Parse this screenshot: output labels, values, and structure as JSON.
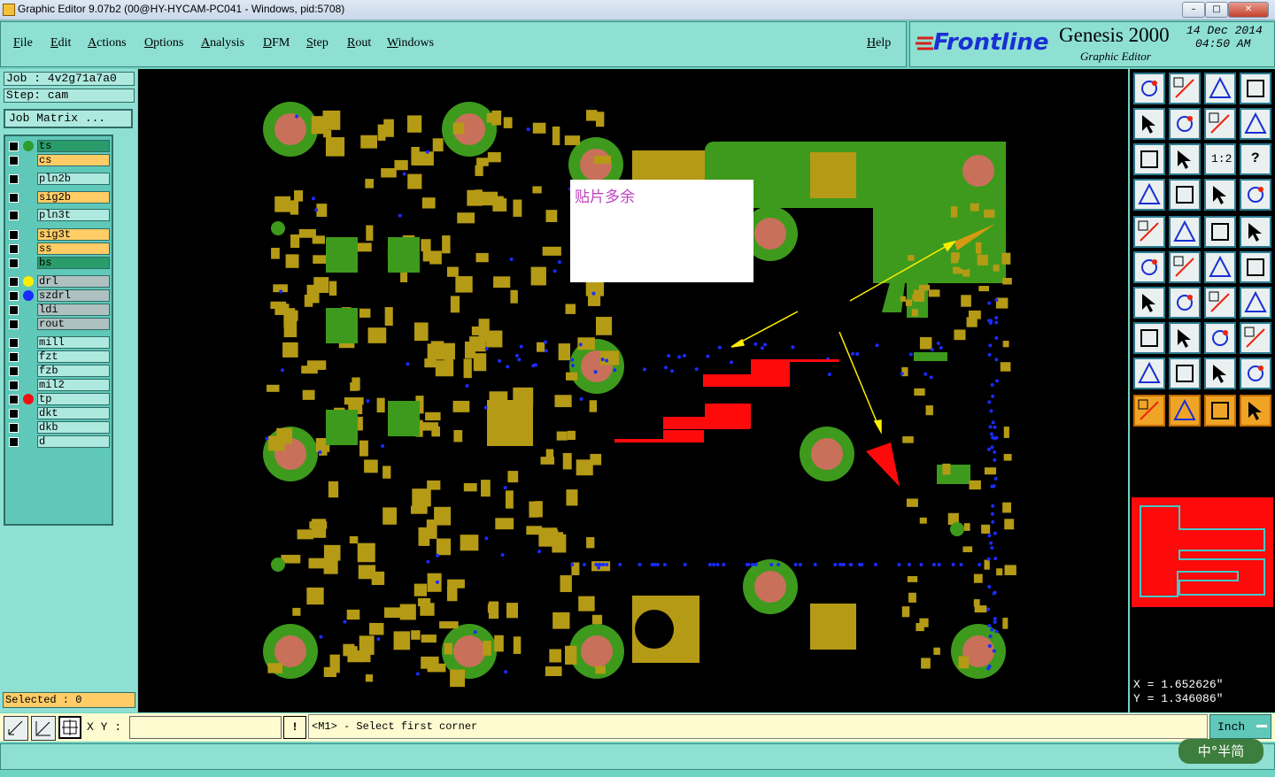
{
  "window": {
    "title": "Graphic Editor 9.07b2 (00@HY-HYCAM-PC041 - Windows, pid:5708)",
    "minimize": "–",
    "maximize": "□",
    "close": "✕"
  },
  "menu": [
    "File",
    "Edit",
    "Actions",
    "Options",
    "Analysis",
    "DFM",
    "Step",
    "Rout",
    "Windows"
  ],
  "help": "Help",
  "brand": {
    "logo": "Frontline",
    "product": "Genesis 2000",
    "subtitle": "Graphic Editor",
    "date": "14 Dec 2014",
    "time": "04:50 AM"
  },
  "job": {
    "job_label": "Job : 4v2g71a7a0",
    "step_label": "Step: cam",
    "matrix_button": "Job Matrix ..."
  },
  "layers": [
    {
      "name": "ts",
      "color": "#2a9b6a",
      "dot": "#2e9b2e"
    },
    {
      "name": "cs",
      "color": "#ffcc66",
      "dot": ""
    },
    {
      "name": "pln2b",
      "color": "#aee9df",
      "dot": ""
    },
    {
      "name": "sig2b",
      "color": "#ffcc66",
      "dot": ""
    },
    {
      "name": "pln3t",
      "color": "#aee9df",
      "dot": ""
    },
    {
      "name": "sig3t",
      "color": "#ffcc66",
      "dot": ""
    },
    {
      "name": "ss",
      "color": "#ffcc66",
      "dot": ""
    },
    {
      "name": "bs",
      "color": "#2a9b6a",
      "dot": ""
    },
    {
      "name": "drl",
      "color": "#aec0c0",
      "dot": "#ffee00"
    },
    {
      "name": "szdrl",
      "color": "#aec0c0",
      "dot": "#1a2cff"
    },
    {
      "name": "ldi",
      "color": "#aec0c0",
      "dot": ""
    },
    {
      "name": "rout",
      "color": "#aec0c0",
      "dot": ""
    },
    {
      "name": "mill",
      "color": "#aee9df",
      "dot": ""
    },
    {
      "name": "fzt",
      "color": "#aee9df",
      "dot": ""
    },
    {
      "name": "fzb",
      "color": "#aee9df",
      "dot": ""
    },
    {
      "name": "mil2",
      "color": "#aee9df",
      "dot": ""
    },
    {
      "name": "tp",
      "color": "#aee9df",
      "dot": "#ee1111"
    },
    {
      "name": "dkt",
      "color": "#aee9df",
      "dot": ""
    },
    {
      "name": "dkb",
      "color": "#aee9df",
      "dot": ""
    },
    {
      "name": "d",
      "color": "#aee9df",
      "dot": ""
    }
  ],
  "selected": "Selected : 0",
  "annotation": "贴片多余",
  "coords": {
    "x": "X = 1.652626\"",
    "y": "Y = 1.346086\""
  },
  "command": {
    "xy_label": "X Y :",
    "xy_value": "",
    "prompt": "<M1> - Select first corner",
    "units": "Inch",
    "excl": "!"
  },
  "ime": "中°半简",
  "tool_labels": {
    "ratio": "1:2",
    "help": "?"
  }
}
